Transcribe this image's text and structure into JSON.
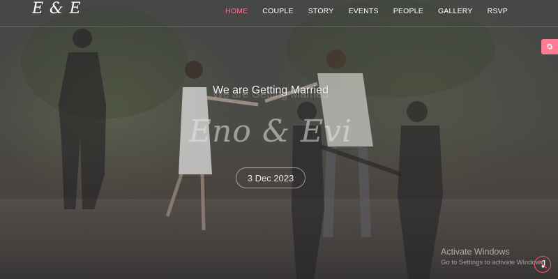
{
  "site": {
    "logo": "E & E"
  },
  "nav": {
    "items": [
      {
        "label": "HOME",
        "active": true
      },
      {
        "label": "COUPLE",
        "active": false
      },
      {
        "label": "STORY",
        "active": false
      },
      {
        "label": "EVENTS",
        "active": false
      },
      {
        "label": "PEOPLE",
        "active": false
      },
      {
        "label": "GALLERY",
        "active": false
      },
      {
        "label": "RSVP",
        "active": false
      }
    ]
  },
  "hero": {
    "tagline": "We are Getting Married",
    "names": "Eno & Evi",
    "date": "3 Dec 2023"
  },
  "overlay": {
    "activate_title": "Activate Windows",
    "activate_subtitle": "Go to Settings to activate Windows."
  },
  "icons": {
    "settings": "gear-icon",
    "music": "music-muted-icon"
  },
  "colors": {
    "accent": "#ff6f8b",
    "settings_bg": "#ff7a93",
    "music_ring": "#ff4f6e"
  }
}
